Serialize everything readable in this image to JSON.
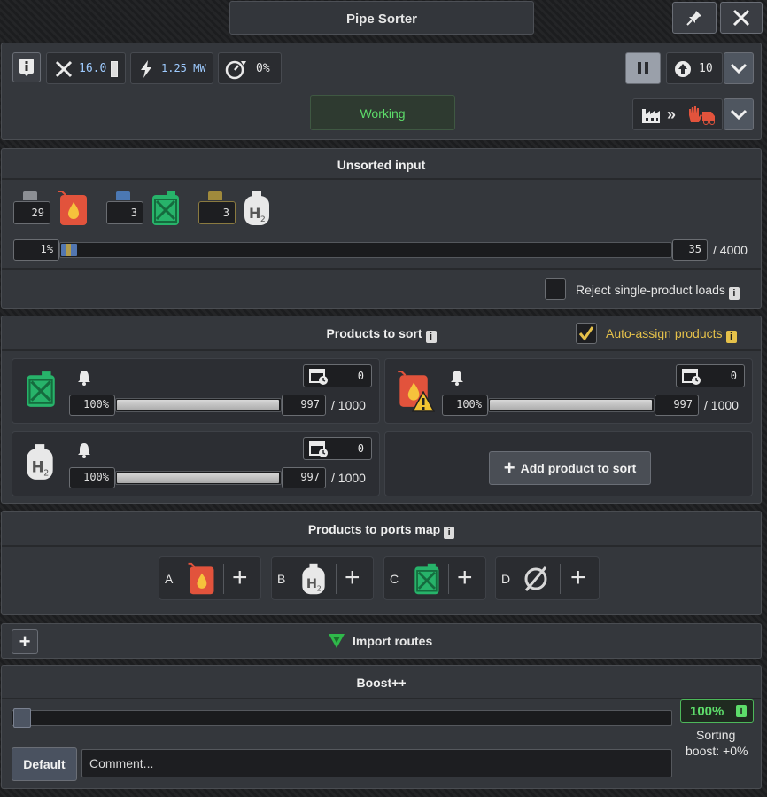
{
  "window": {
    "title": "Pipe Sorter"
  },
  "header": {
    "pin_icon": "pin-icon",
    "close_icon": "close-icon"
  },
  "stats": {
    "workers": "16.0",
    "power": "1.25 MW",
    "efficiency": "0%",
    "priority": "10",
    "status": "Working"
  },
  "unsorted": {
    "title": "Unsorted input",
    "items": [
      {
        "count": "29",
        "product": "diesel-can"
      },
      {
        "count": "3",
        "product": "green-can"
      },
      {
        "count": "3",
        "product": "hydrogen-can"
      }
    ],
    "percent": "1%",
    "fill": 0.01,
    "amount": "35",
    "capacity": "/ 4000",
    "reject_label": "Reject single-product loads"
  },
  "products": {
    "title": "Products to sort",
    "auto_assign_label": "Auto-assign products",
    "cards": [
      {
        "product": "green-can",
        "percent": "100%",
        "amount": "997",
        "capacity": "/ 1000",
        "counter": "0",
        "fill": 0.997
      },
      {
        "product": "diesel-can",
        "percent": "100%",
        "amount": "997",
        "capacity": "/ 1000",
        "counter": "0",
        "fill": 0.997,
        "warning": true
      },
      {
        "product": "hydrogen-can",
        "percent": "100%",
        "amount": "997",
        "capacity": "/ 1000",
        "counter": "0",
        "fill": 0.997
      }
    ],
    "add_label": "Add product to sort"
  },
  "ports": {
    "title": "Products to ports map",
    "items": [
      {
        "letter": "A",
        "product": "diesel-can"
      },
      {
        "letter": "B",
        "product": "hydrogen-can"
      },
      {
        "letter": "C",
        "product": "green-can"
      },
      {
        "letter": "D",
        "product": "empty-set"
      }
    ]
  },
  "routes": {
    "label": "Import routes"
  },
  "boost": {
    "title": "Boost++",
    "value": "100%",
    "sorting": "Sorting",
    "boost_text": "boost: +0%",
    "default_label": "Default",
    "comment_placeholder": "Comment..."
  },
  "colors": {
    "accent_green": "#5ddc6a",
    "diesel_red": "#e2533c",
    "green_can": "#27b36a",
    "gold": "#e5c14a"
  }
}
